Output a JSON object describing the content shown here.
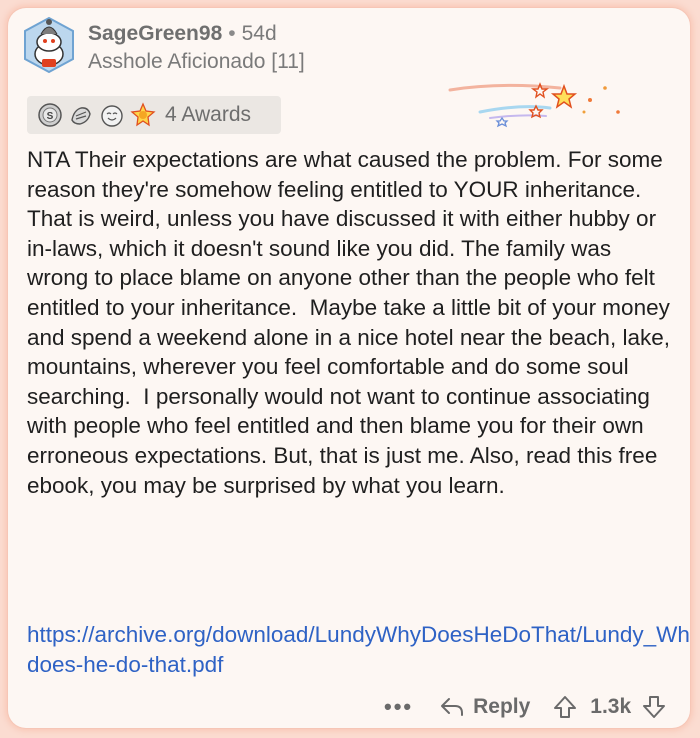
{
  "comment": {
    "username": "SageGreen98",
    "age": "54d",
    "separator": "•",
    "flair": "Asshole Aficionado [11]",
    "awards": {
      "label": "4 Awards",
      "icons": [
        "silver-award-icon",
        "helpful-hand-award-icon",
        "wholesome-face-award-icon",
        "starstruck-award-icon"
      ]
    },
    "body": "NTA Their expectations are what caused the problem. For some reason they're somehow feeling entitled to YOUR inheritance. That is weird, unless you have discussed it with either hubby or in-laws, which it doesn't sound like you did. The family was wrong to place blame on anyone other than the people who felt entitled to your inheritance.  Maybe take a little bit of your money and spend a weekend alone in a nice hotel near the beach, lake, mountains, wherever you feel comfortable and do some soul searching.  I personally would not want to continue associating with people who feel entitled and then blame you for their own erroneous expectations. But, that is just me. Also, read this free ebook, you may be surprised by what you learn.",
    "link": "https://archive.org/download/LundyWhyDoesHeDoThat/Lundy_Why-does-he-do-that.pdf"
  },
  "actions": {
    "more": "•••",
    "reply": "Reply",
    "votes": "1.3k"
  },
  "colors": {
    "background": "#fbdcd1",
    "card": "#fdf7f3",
    "link": "#2e62c5",
    "text": "#1f1f1f",
    "muted": "#6f6f6f"
  }
}
